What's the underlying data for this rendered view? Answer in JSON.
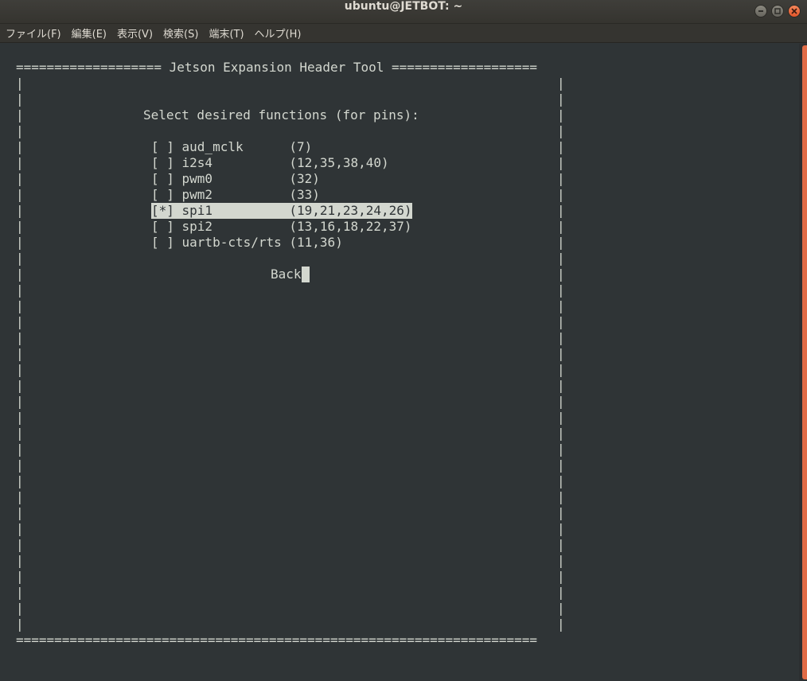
{
  "window": {
    "title": "ubuntu@JETBOT: ~"
  },
  "menu": {
    "items": [
      "ファイル(F)",
      "編集(E)",
      "表示(V)",
      "検索(S)",
      "端末(T)",
      "ヘルプ(H)"
    ]
  },
  "terminal": {
    "header": "=================== Jetson Expansion Header Tool ===================",
    "prompt": "Select desired functions (for pins):",
    "options": [
      {
        "check": "[ ]",
        "name": "aud_mclk",
        "pins": "(7)"
      },
      {
        "check": "[ ]",
        "name": "i2s4",
        "pins": "(12,35,38,40)"
      },
      {
        "check": "[ ]",
        "name": "pwm0",
        "pins": "(32)"
      },
      {
        "check": "[ ]",
        "name": "pwm2",
        "pins": "(33)"
      },
      {
        "check": "[*]",
        "name": "spi1",
        "pins": "(19,21,23,24,26)"
      },
      {
        "check": "[ ]",
        "name": "spi2",
        "pins": "(13,16,18,22,37)"
      },
      {
        "check": "[ ]",
        "name": "uartb-cts/rts",
        "pins": "(11,36)"
      }
    ],
    "back_label": "Back",
    "footer": "===================================================================="
  },
  "colors": {
    "terminal_bg": "#2f3436",
    "terminal_fg": "#d3d7cf",
    "accent": "#e06b46"
  }
}
